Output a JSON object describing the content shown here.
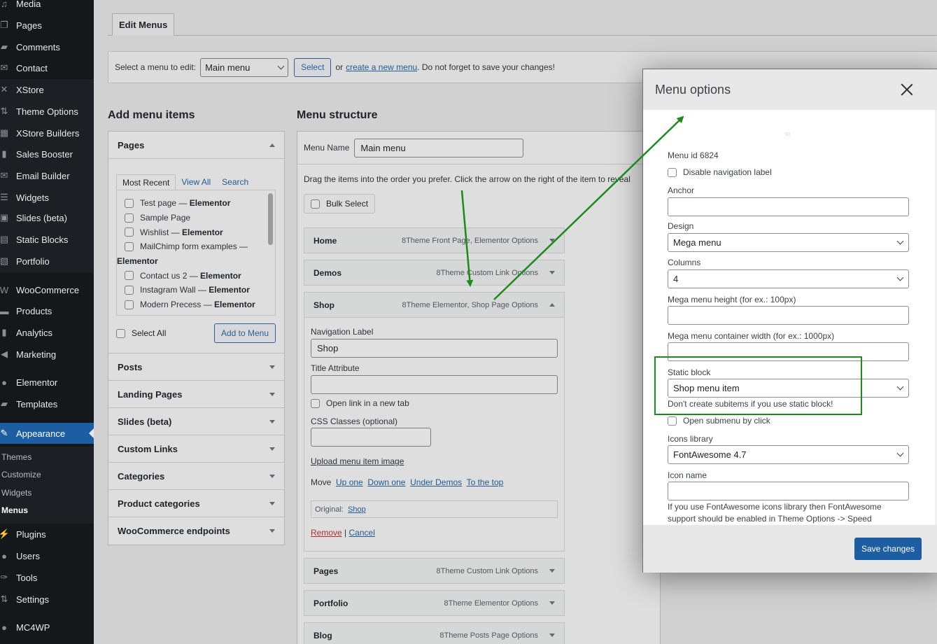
{
  "sidebar": {
    "items": [
      {
        "label": "Media",
        "icon": "media-icon",
        "glyph": "♫"
      },
      {
        "label": "Pages",
        "icon": "pages-icon",
        "glyph": "❐"
      },
      {
        "label": "Comments",
        "icon": "comments-icon",
        "glyph": "▰"
      },
      {
        "label": "Contact",
        "icon": "envelope-icon",
        "glyph": "✉"
      },
      {
        "label": "XStore",
        "icon": "xstore-icon",
        "glyph": "✕"
      },
      {
        "label": "Theme Options",
        "icon": "theme-options-icon",
        "glyph": "⇅"
      },
      {
        "label": "XStore Builders",
        "icon": "builders-icon",
        "glyph": "▦"
      },
      {
        "label": "Sales Booster",
        "icon": "bar-chart-icon",
        "glyph": "▮"
      },
      {
        "label": "Email Builder",
        "icon": "email-icon",
        "glyph": "✉"
      },
      {
        "label": "Widgets",
        "icon": "widgets-icon",
        "glyph": "☰"
      },
      {
        "label": "Slides (beta)",
        "icon": "slides-icon",
        "glyph": "▣"
      },
      {
        "label": "Static Blocks",
        "icon": "static-blocks-icon",
        "glyph": "▤"
      },
      {
        "label": "Portfolio",
        "icon": "portfolio-icon",
        "glyph": "▧"
      },
      {
        "label": "WooCommerce",
        "icon": "woocommerce-icon",
        "glyph": "W"
      },
      {
        "label": "Products",
        "icon": "products-icon",
        "glyph": "▬"
      },
      {
        "label": "Analytics",
        "icon": "analytics-icon",
        "glyph": "▮"
      },
      {
        "label": "Marketing",
        "icon": "megaphone-icon",
        "glyph": "◀"
      },
      {
        "label": "Elementor",
        "icon": "elementor-icon",
        "glyph": "●"
      },
      {
        "label": "Templates",
        "icon": "folder-icon",
        "glyph": "▰"
      },
      {
        "label": "Appearance",
        "icon": "brush-icon",
        "glyph": "✎"
      },
      {
        "label": "Plugins",
        "icon": "plug-icon",
        "glyph": "⚡"
      },
      {
        "label": "Users",
        "icon": "user-icon",
        "glyph": "●"
      },
      {
        "label": "Tools",
        "icon": "wrench-icon",
        "glyph": "✑"
      },
      {
        "label": "Settings",
        "icon": "settings-icon",
        "glyph": "⇅"
      },
      {
        "label": "MC4WP",
        "icon": "mc4wp-icon",
        "glyph": "●"
      }
    ],
    "submenu": [
      "Themes",
      "Customize",
      "Widgets",
      "Menus"
    ],
    "active_color": "#1d5ea3"
  },
  "tabs": {
    "edit_menus": "Edit Menus"
  },
  "select_bar": {
    "label": "Select a menu to edit:",
    "selected": "Main menu",
    "select_button": "Select",
    "or": "or",
    "create_link": "create a new menu",
    "suffix": ". Do not forget to save your changes!"
  },
  "add_items": {
    "heading": "Add menu items",
    "pages": {
      "title": "Pages",
      "tabs": [
        "Most Recent",
        "View All",
        "Search"
      ],
      "list": [
        {
          "name": "Test page",
          "suffix": "Elementor"
        },
        {
          "name": "Sample Page",
          "suffix": ""
        },
        {
          "name": "Wishlist",
          "suffix": "Elementor"
        },
        {
          "name": "MailChimp form examples",
          "suffix": "Elementor"
        },
        {
          "name": "Contact us 2",
          "suffix": "Elementor"
        },
        {
          "name": "Instagram Wall",
          "suffix": "Elementor"
        },
        {
          "name": "Modern Precess",
          "suffix": "Elementor"
        }
      ],
      "select_all": "Select All",
      "add_button": "Add to Menu"
    },
    "sections": [
      "Posts",
      "Landing Pages",
      "Slides (beta)",
      "Custom Links",
      "Categories",
      "Product categories",
      "WooCommerce endpoints"
    ]
  },
  "structure": {
    "heading": "Menu structure",
    "menu_name_label": "Menu Name",
    "menu_name_value": "Main menu",
    "hint": "Drag the items into the order you prefer. Click the arrow on the right of the item to reveal",
    "bulk_select": "Bulk Select",
    "items": [
      {
        "title": "Home",
        "type": "8Theme Front Page, Elementor Options"
      },
      {
        "title": "Demos",
        "type": "8Theme Custom Link Options"
      },
      {
        "title": "Shop",
        "type": "8Theme Elementor, Shop Page Options"
      },
      {
        "title": "Pages",
        "type": "8Theme Custom Link Options"
      },
      {
        "title": "Portfolio",
        "type": "8Theme Elementor Options"
      },
      {
        "title": "Blog",
        "type": "8Theme Posts Page Options"
      }
    ],
    "shop_settings": {
      "nav_label_label": "Navigation Label",
      "nav_label_value": "Shop",
      "title_attr_label": "Title Attribute",
      "title_attr_value": "",
      "new_tab_label": "Open link in a new tab",
      "css_label": "CSS Classes (optional)",
      "css_value": "",
      "upload_link": "Upload menu item image",
      "move_label": "Move",
      "move_links": [
        "Up one",
        "Down one",
        "Under Demos",
        "To the top"
      ],
      "original_label": "Original:",
      "original_link": "Shop",
      "remove": "Remove",
      "separator": "|",
      "cancel": "Cancel"
    }
  },
  "modal": {
    "title": "Menu options",
    "spinner": "∞",
    "menu_id": "Menu id 6824",
    "disable_nav_label": "Disable navigation label",
    "anchor_label": "Anchor",
    "anchor_value": "",
    "design_label": "Design",
    "design_value": "Mega menu",
    "columns_label": "Columns",
    "columns_value": "4",
    "height_label": "Mega menu height (for ex.: 100px)",
    "height_value": "",
    "width_label": "Mega menu container width (for ex.: 1000px)",
    "width_value": "",
    "static_block_label": "Static block",
    "static_block_value": "Shop menu item",
    "static_block_note": "Don't create subitems if you use static block!",
    "open_submenu_label": "Open submenu by click",
    "icons_library_label": "Icons library",
    "icons_library_value": "FontAwesome 4.7",
    "icon_name_label": "Icon name",
    "icon_name_value": "",
    "icon_note_1": "If you use FontAwesome icons library then FontAwesome",
    "icon_note_2": "support should be enabled in Theme Options -> Speed",
    "save_button": "Save changes",
    "primary_color": "#1d5ea3",
    "annotation_color": "#1c8a1c"
  }
}
